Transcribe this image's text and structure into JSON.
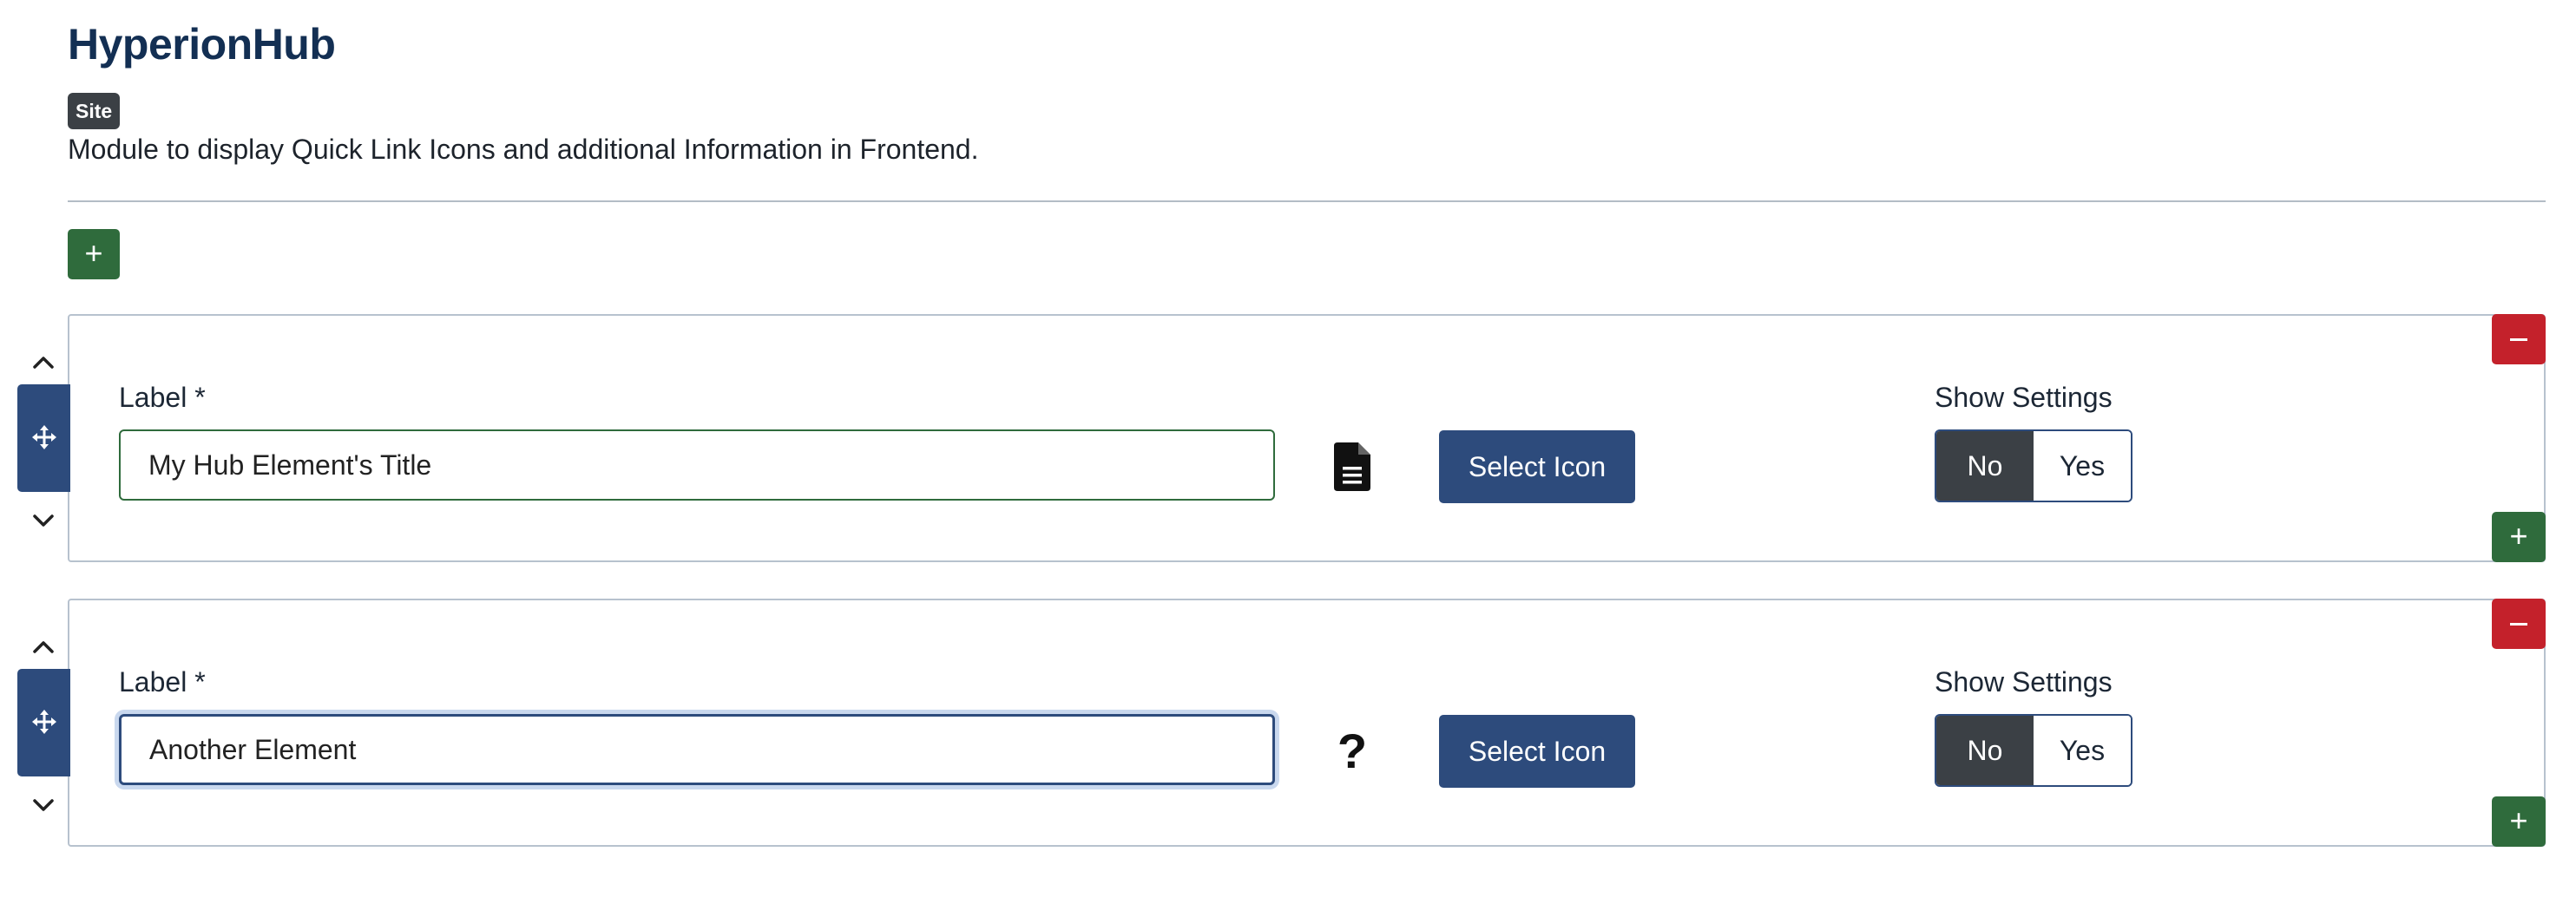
{
  "header": {
    "title": "HyperionHub",
    "badge": "Site",
    "description": "Module to display Quick Link Icons and additional Information in Frontend."
  },
  "colors": {
    "primary": "#2d4b7c",
    "success": "#2f6b3c",
    "danger": "#c4212b",
    "dark": "#3b4045"
  },
  "add_button_icon": "plus-icon",
  "rows": [
    {
      "label": "Label *",
      "input_value": "My Hub Element's Title",
      "icon": "file-text-icon",
      "select_icon_label": "Select Icon",
      "settings_label": "Show Settings",
      "toggle_no": "No",
      "toggle_yes": "Yes",
      "toggle_selected": "No"
    },
    {
      "label": "Label *",
      "input_value": "Another Element",
      "icon": "question-icon",
      "icon_glyph": "?",
      "select_icon_label": "Select Icon",
      "settings_label": "Show Settings",
      "toggle_no": "No",
      "toggle_yes": "Yes",
      "toggle_selected": "No"
    }
  ]
}
